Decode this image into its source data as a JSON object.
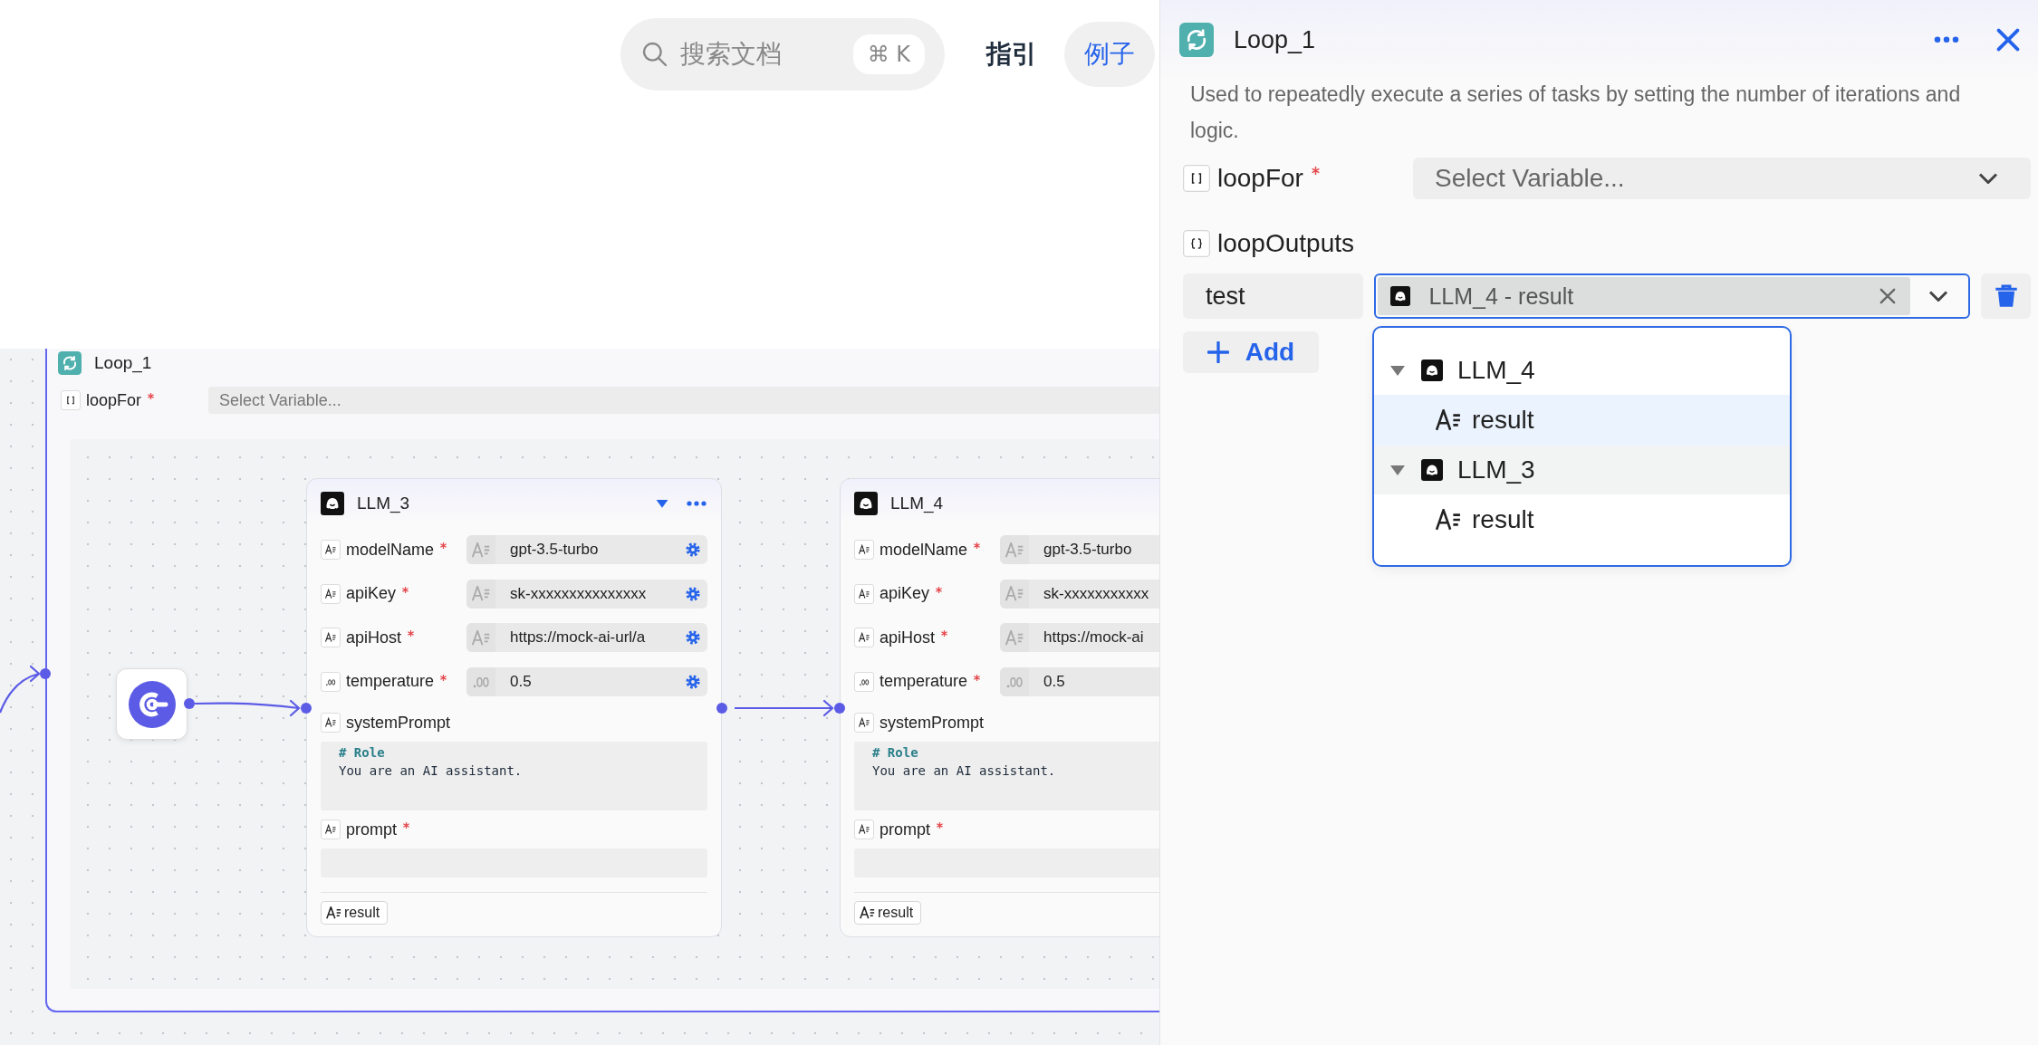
{
  "top_bar": {
    "search": {
      "placeholder": "搜索文档",
      "shortcut": "⌘ K"
    },
    "nav": [
      {
        "label": "指引",
        "selected": false
      },
      {
        "label": "例子",
        "selected": true
      }
    ]
  },
  "canvas": {
    "loop_node": {
      "title": "Loop_1",
      "loop_for": {
        "label": "loopFor",
        "badge": {
          "kind": "array"
        },
        "required": true,
        "placeholder": "Select Variable..."
      }
    },
    "nodes": [
      {
        "title": "LLM_3",
        "actions": [
          {
            "kind": "collapse"
          },
          {
            "kind": "more"
          }
        ],
        "fields": [
          {
            "kind": "input",
            "label": "modelName",
            "badge": {
              "kind": "string"
            },
            "required": true,
            "value": "gpt-3.5-turbo",
            "config_button": true
          },
          {
            "kind": "input",
            "label": "apiKey",
            "badge": {
              "kind": "string"
            },
            "required": true,
            "value": "sk-xxxxxxxxxxxxxxx",
            "config_button": true
          },
          {
            "kind": "input",
            "label": "apiHost",
            "badge": {
              "kind": "string"
            },
            "required": true,
            "value": "https://mock-ai-url/a",
            "config_button": true
          },
          {
            "kind": "input",
            "label": "temperature",
            "badge": {
              "kind": "number"
            },
            "required": true,
            "value": "0.5",
            "config_button": true
          },
          {
            "kind": "textarea",
            "label": "systemPrompt",
            "badge": {
              "kind": "string"
            },
            "required": false,
            "lines": [
              {
                "kind": "heading",
                "text": "# Role"
              },
              {
                "kind": "text",
                "text": "You are an AI assistant."
              }
            ]
          },
          {
            "kind": "textarea",
            "label": "prompt",
            "badge": {
              "kind": "string"
            },
            "required": true
          }
        ],
        "outputs": [
          {
            "label": "result",
            "badge": {
              "kind": "string"
            }
          }
        ]
      },
      {
        "title": "LLM_4",
        "fields": [
          {
            "kind": "input",
            "label": "modelName",
            "badge": {
              "kind": "string"
            },
            "required": true,
            "value": "gpt-3.5-turbo"
          },
          {
            "kind": "input",
            "label": "apiKey",
            "badge": {
              "kind": "string"
            },
            "required": true,
            "value": "sk-xxxxxxxxxxx"
          },
          {
            "kind": "input",
            "label": "apiHost",
            "badge": {
              "kind": "string"
            },
            "required": true,
            "value": "https://mock-ai"
          },
          {
            "kind": "input",
            "label": "temperature",
            "badge": {
              "kind": "number"
            },
            "required": true,
            "value": "0.5"
          },
          {
            "kind": "textarea",
            "label": "systemPrompt",
            "badge": {
              "kind": "string"
            },
            "required": false,
            "lines": [
              {
                "kind": "heading",
                "text": "# Role"
              },
              {
                "kind": "text",
                "text": "You are an AI assistant."
              }
            ]
          },
          {
            "kind": "textarea",
            "label": "prompt",
            "badge": {
              "kind": "string"
            },
            "required": true
          }
        ],
        "outputs": [
          {
            "label": "result",
            "badge": {
              "kind": "string"
            }
          }
        ]
      }
    ]
  },
  "panel": {
    "title": "Loop_1",
    "actions": [
      {
        "kind": "more"
      },
      {
        "kind": "close"
      }
    ],
    "description": "Used to repeatedly execute a series of tasks by setting the number of iterations and logic.",
    "loop_for": {
      "label": "loopFor",
      "badge": {
        "kind": "array"
      },
      "required": true,
      "placeholder": "Select Variable..."
    },
    "loop_outputs": {
      "label": "loopOutputs",
      "badge": {
        "kind": "object"
      },
      "items": [
        {
          "name": "test",
          "value": "LLM_4 - result",
          "focused": true
        }
      ]
    },
    "add_button": "Add",
    "dropdown": {
      "groups": [
        {
          "label": "LLM_4",
          "expanded": true,
          "hovered": false,
          "children": [
            {
              "label": "result",
              "badge": {
                "kind": "string"
              },
              "selected": true
            }
          ]
        },
        {
          "label": "LLM_3",
          "expanded": true,
          "hovered": true,
          "children": [
            {
              "label": "result",
              "badge": {
                "kind": "string"
              },
              "selected": false
            }
          ]
        }
      ]
    }
  }
}
